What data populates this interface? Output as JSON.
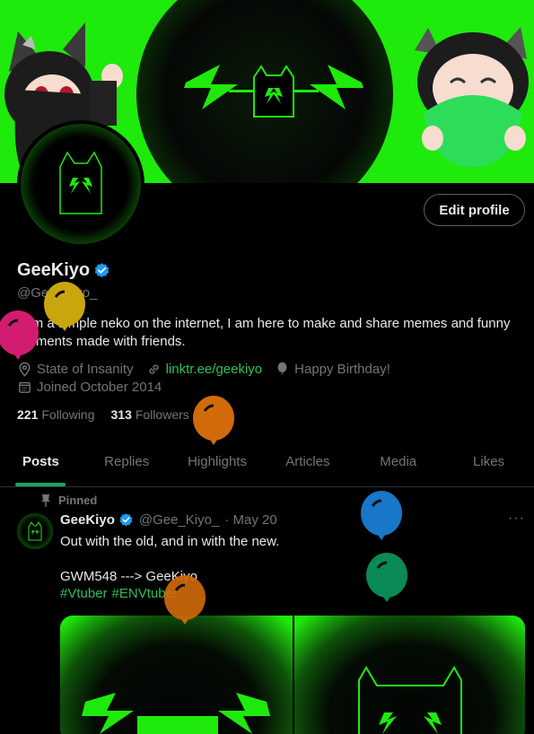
{
  "profile": {
    "display_name": "GeeKiyo",
    "handle": "@Gee_Kiyo_",
    "bio": "I am a simple neko on the internet, I am here to make and share memes and funny moments made with friends.",
    "location": "State of Insanity",
    "website": "linktr.ee/geekiyo",
    "birthday": "Happy Birthday!",
    "joined": "Joined October 2014",
    "following_count": "221",
    "following_label": "Following",
    "followers_count": "313",
    "followers_label": "Followers",
    "edit_button": "Edit profile"
  },
  "tabs": [
    {
      "label": "Posts",
      "active": true
    },
    {
      "label": "Replies",
      "active": false
    },
    {
      "label": "Highlights",
      "active": false
    },
    {
      "label": "Articles",
      "active": false
    },
    {
      "label": "Media",
      "active": false
    },
    {
      "label": "Likes",
      "active": false
    }
  ],
  "post": {
    "pinned_label": "Pinned",
    "author": "GeeKiyo",
    "handle": "@Gee_Kiyo_",
    "date": "· May 20",
    "more": "···",
    "text": "Out with the old, and in with the new.\n\nGWM548 ---> GeeKiyo",
    "hashtags": [
      "#Vtuber",
      "#ENVtuber"
    ]
  },
  "icons": {
    "verified": "verified-badge-icon",
    "location": "location-pin-icon",
    "link": "link-icon",
    "balloon": "balloon-icon",
    "calendar": "calendar-icon",
    "pin": "pin-icon"
  },
  "colors": {
    "accent_green": "#1eea0c",
    "verified_blue": "#1d9bf0",
    "balloons": [
      "#d21c6f",
      "#c9a50e",
      "#d26a0a",
      "#1877c8",
      "#0a8a55",
      "#d26a0a"
    ]
  }
}
